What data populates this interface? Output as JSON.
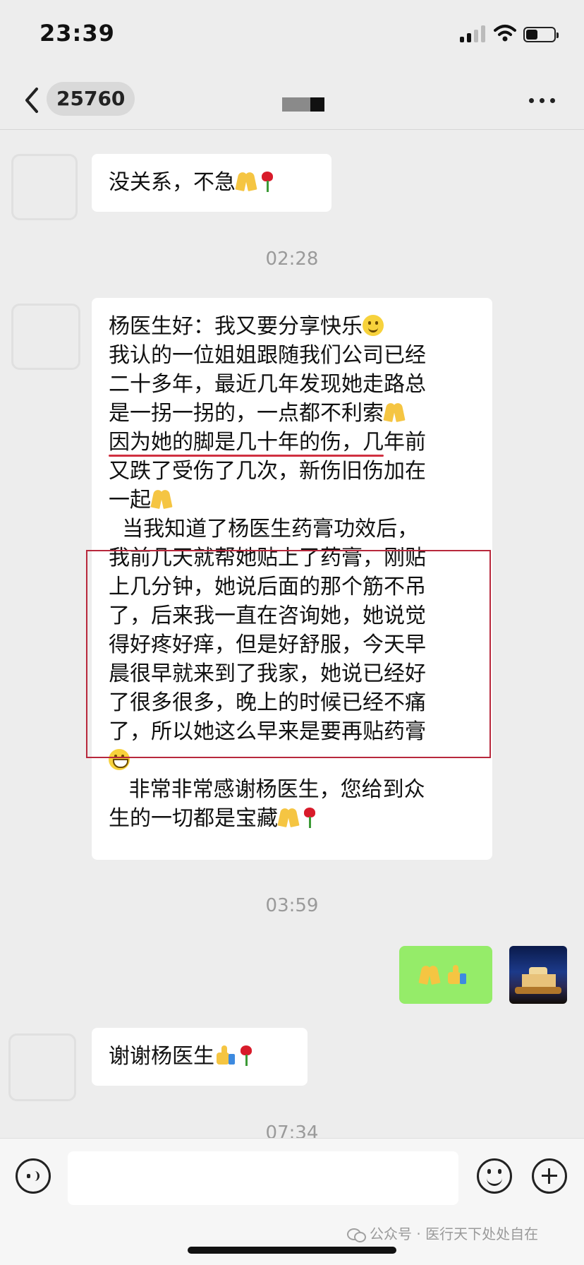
{
  "status_bar": {
    "time": "23:39"
  },
  "header": {
    "chat_count": "25760",
    "back_label": "‹"
  },
  "messages": {
    "m1": "没关系，不急",
    "t1": "02:28",
    "m2_l1": "杨医生好：我又要分享快乐",
    "m2_body": "我认的一位姐姐跟随我们公司已经\n二十多年，最近几年发现她走路总\n是一拐一拐的，一点都不利索",
    "m2_l5": "因为她的脚是几十年的伤，几年前",
    "m2_l6": "又跌了受伤了几次，新伤旧伤加在",
    "m2_l7": "一起",
    "m2_l8": "  当我知道了杨医生药膏功效后，",
    "m2_box": "我前几天就帮她贴上了药膏，刚贴\n上几分钟，她说后面的那个筋不吊\n了，后来我一直在咨询她，她说觉\n得好疼好痒，但是好舒服，今天早\n晨很早就来到了我家，她说已经好\n了很多很多，晚上的时候已经不痛\n了，所以她这么早来是要再贴药膏",
    "m2_end1": "   非常非常感谢杨医生，您给到众",
    "m2_end2": "生的一切都是宝藏",
    "t2": "03:59",
    "m4": "谢谢杨医生",
    "t3": "07:34"
  },
  "input": {
    "placeholder": ""
  },
  "watermark": {
    "text": "公众号 · 医行天下处处自在"
  },
  "icons": {
    "pray": "folded-hands-icon",
    "rose": "rose-icon",
    "smile": "smile-icon",
    "grin": "grin-icon",
    "thumb": "thumbs-up-icon"
  },
  "colors": {
    "background": "#ededed",
    "my_bubble": "#95ec69",
    "other_bubble": "#ffffff",
    "highlight_border": "#b8283c"
  }
}
